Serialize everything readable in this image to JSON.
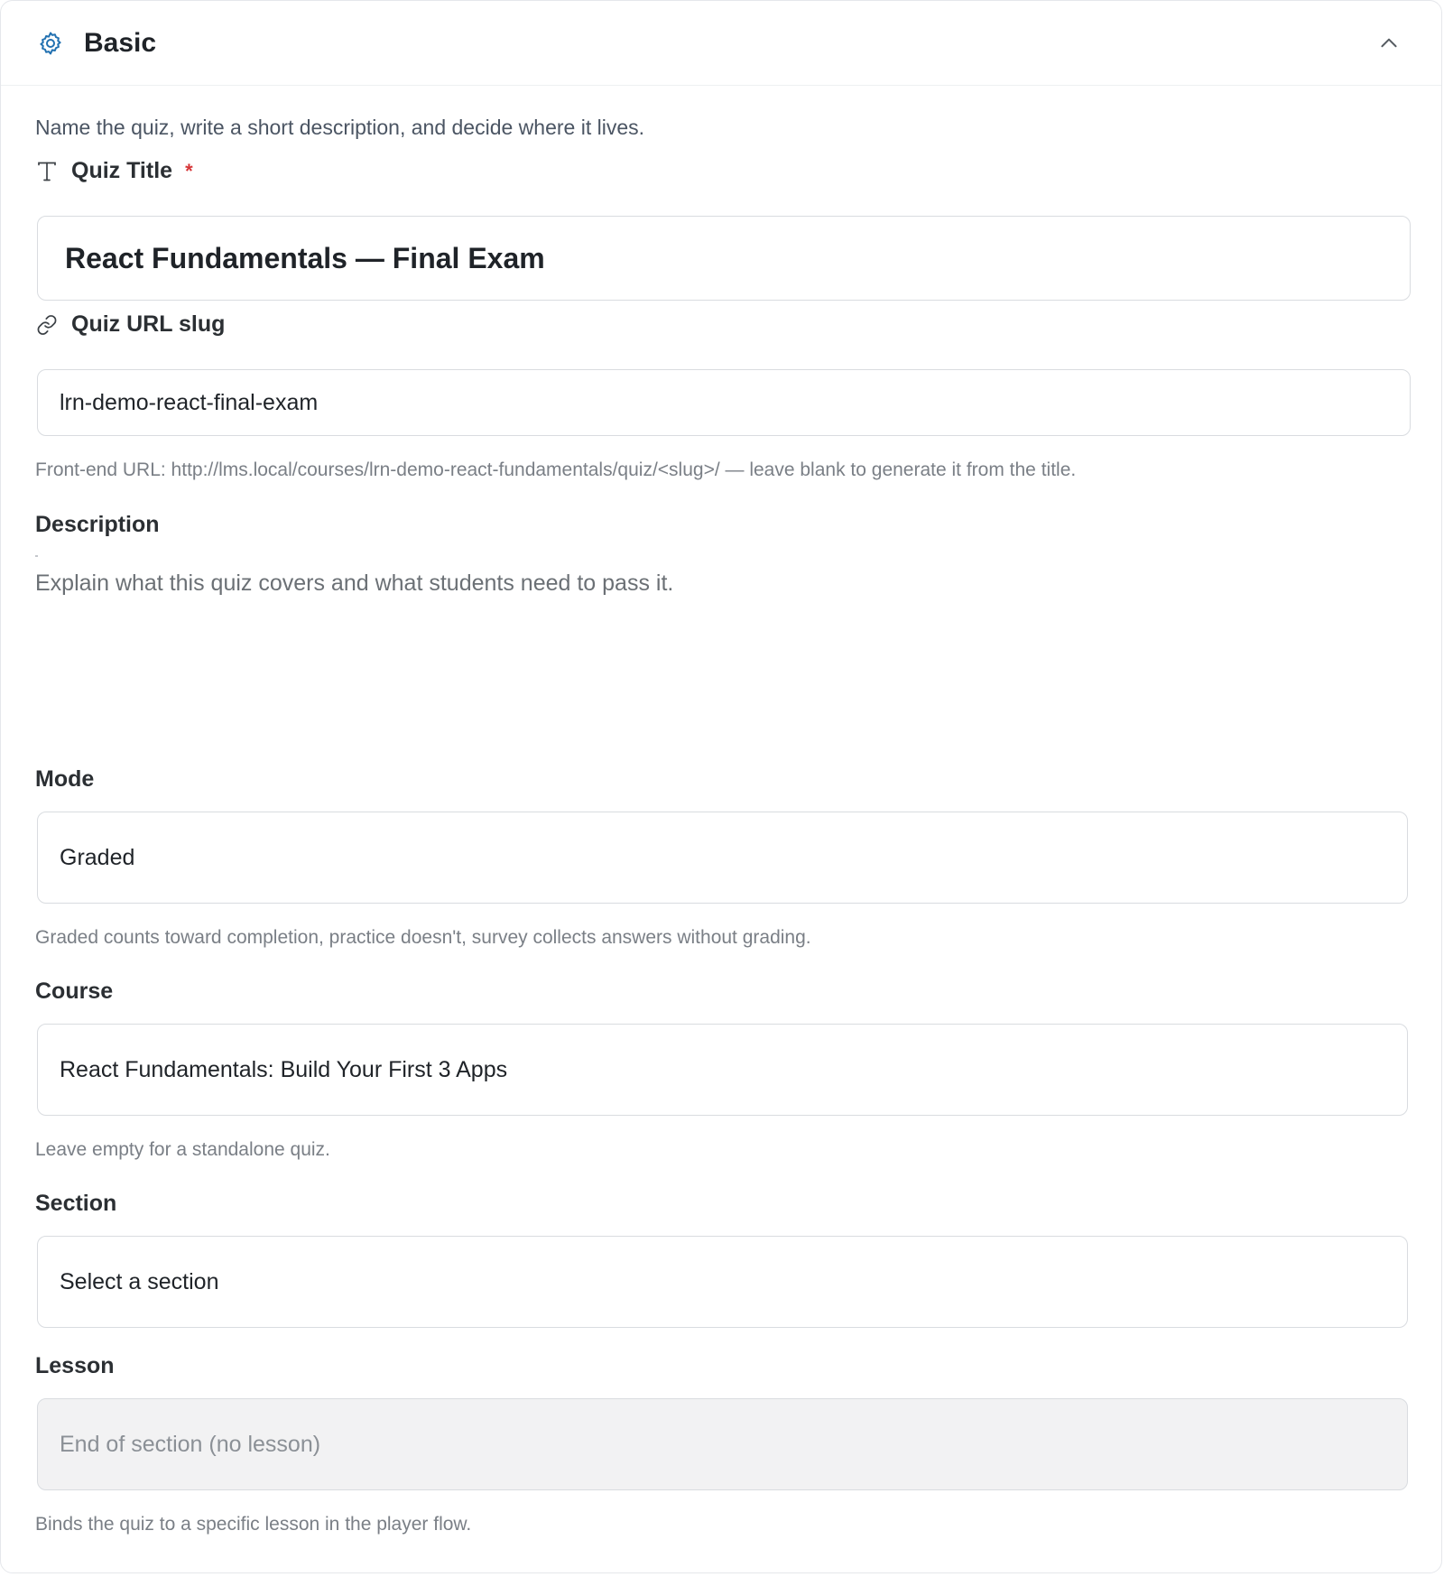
{
  "panel": {
    "title": "Basic",
    "header_icon": "gear-icon",
    "collapse_icon": "chevron-up-icon",
    "intro": "Name the quiz, write a short description, and decide where it lives.",
    "accent_color": "#2271b1",
    "required_color": "#d63638"
  },
  "fields": {
    "title": {
      "label": "Quiz Title",
      "icon": "text-type-icon",
      "required_mark": "*",
      "value": "React Fundamentals — Final Exam"
    },
    "slug": {
      "label": "Quiz URL slug",
      "icon": "link-icon",
      "value": "lrn-demo-react-final-exam",
      "help": "Front-end URL: http://lms.local/courses/lrn-demo-react-fundamentals/quiz/<slug>/ — leave blank to generate it from the title."
    },
    "description": {
      "label": "Description",
      "placeholder": "Explain what this quiz covers and what students need to pass it."
    },
    "mode": {
      "label": "Mode",
      "value": "Graded",
      "help": "Graded counts toward completion, practice doesn't, survey collects answers without grading."
    },
    "course": {
      "label": "Course",
      "value": "React Fundamentals: Build Your First 3 Apps",
      "help": "Leave empty for a standalone quiz."
    },
    "section": {
      "label": "Section",
      "value": "Select a section"
    },
    "lesson": {
      "label": "Lesson",
      "value": "End of section (no lesson)",
      "help": "Binds the quiz to a specific lesson in the player flow."
    }
  }
}
